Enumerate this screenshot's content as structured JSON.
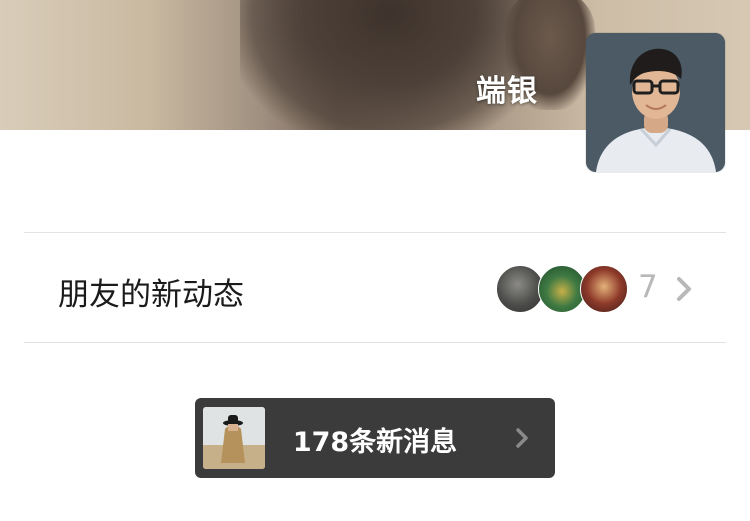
{
  "profile": {
    "name": "端银"
  },
  "friends_feed": {
    "label": "朋友的新动态",
    "count": "7"
  },
  "new_messages": {
    "label": "178条新消息"
  },
  "icons": {
    "chevron": "chevron-right-icon"
  },
  "colors": {
    "pill_background": "#3b3b3b",
    "count_text": "#b8b8b8",
    "divider": "#e3e3e3"
  }
}
